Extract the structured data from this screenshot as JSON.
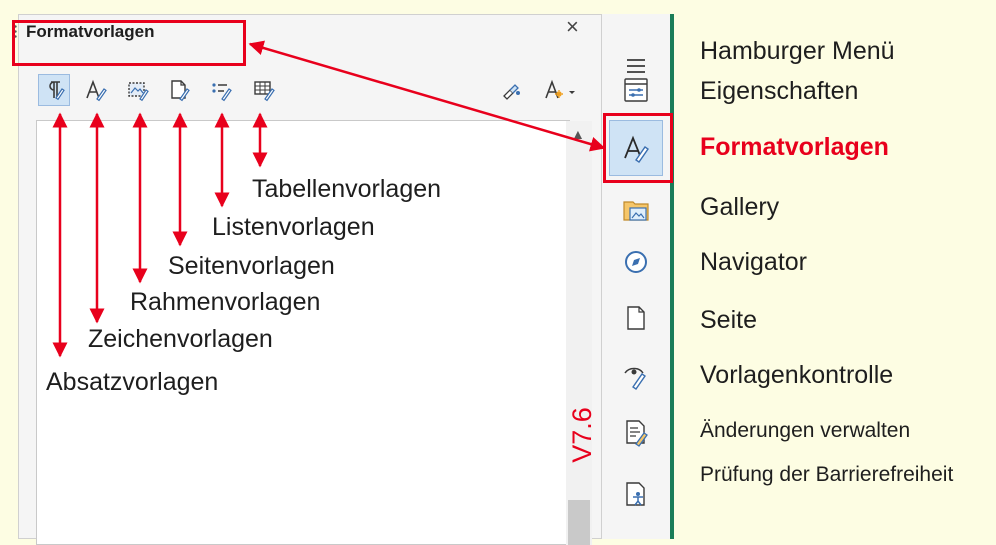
{
  "panel": {
    "title": "Formatvorlagen",
    "close_glyph": "×",
    "menu_glyph": "≡",
    "version_label": "V7.6",
    "toolbar_buttons": [
      {
        "name": "paragraph-styles-icon",
        "active": true
      },
      {
        "name": "character-styles-icon",
        "active": false
      },
      {
        "name": "frame-styles-icon",
        "active": false
      },
      {
        "name": "page-styles-icon",
        "active": false
      },
      {
        "name": "list-styles-icon",
        "active": false
      },
      {
        "name": "table-styles-icon",
        "active": false
      }
    ],
    "toolbar_right": [
      {
        "name": "fill-format-mode-icon"
      },
      {
        "name": "style-actions-icon"
      }
    ]
  },
  "annotations": [
    "Tabellenvorlagen",
    "Listenvorlagen",
    "Seitenvorlagen",
    "Rahmenvorlagen",
    "Zeichenvorlagen",
    "Absatzvorlagen"
  ],
  "tabs": [
    {
      "label": "Hamburger Menü",
      "icon": "hamburger-menu-icon"
    },
    {
      "label": "Eigenschaften",
      "icon": "properties-icon"
    },
    {
      "label": "Formatvorlagen",
      "icon": "styles-icon",
      "active": true
    },
    {
      "label": "Gallery",
      "icon": "gallery-icon"
    },
    {
      "label": "Navigator",
      "icon": "navigator-icon"
    },
    {
      "label": "Seite",
      "icon": "page-icon"
    },
    {
      "label": "Vorlagenkontrolle",
      "icon": "style-inspector-icon"
    },
    {
      "label": "Änderungen verwalten",
      "icon": "manage-changes-icon"
    },
    {
      "label": "Prüfung der Barrierefreiheit",
      "icon": "accessibility-check-icon"
    }
  ],
  "colors": {
    "background": "#fdfde3",
    "highlight": "#e8001c",
    "accent_border": "#1a7d58",
    "active_button": "#cfe3f5"
  }
}
